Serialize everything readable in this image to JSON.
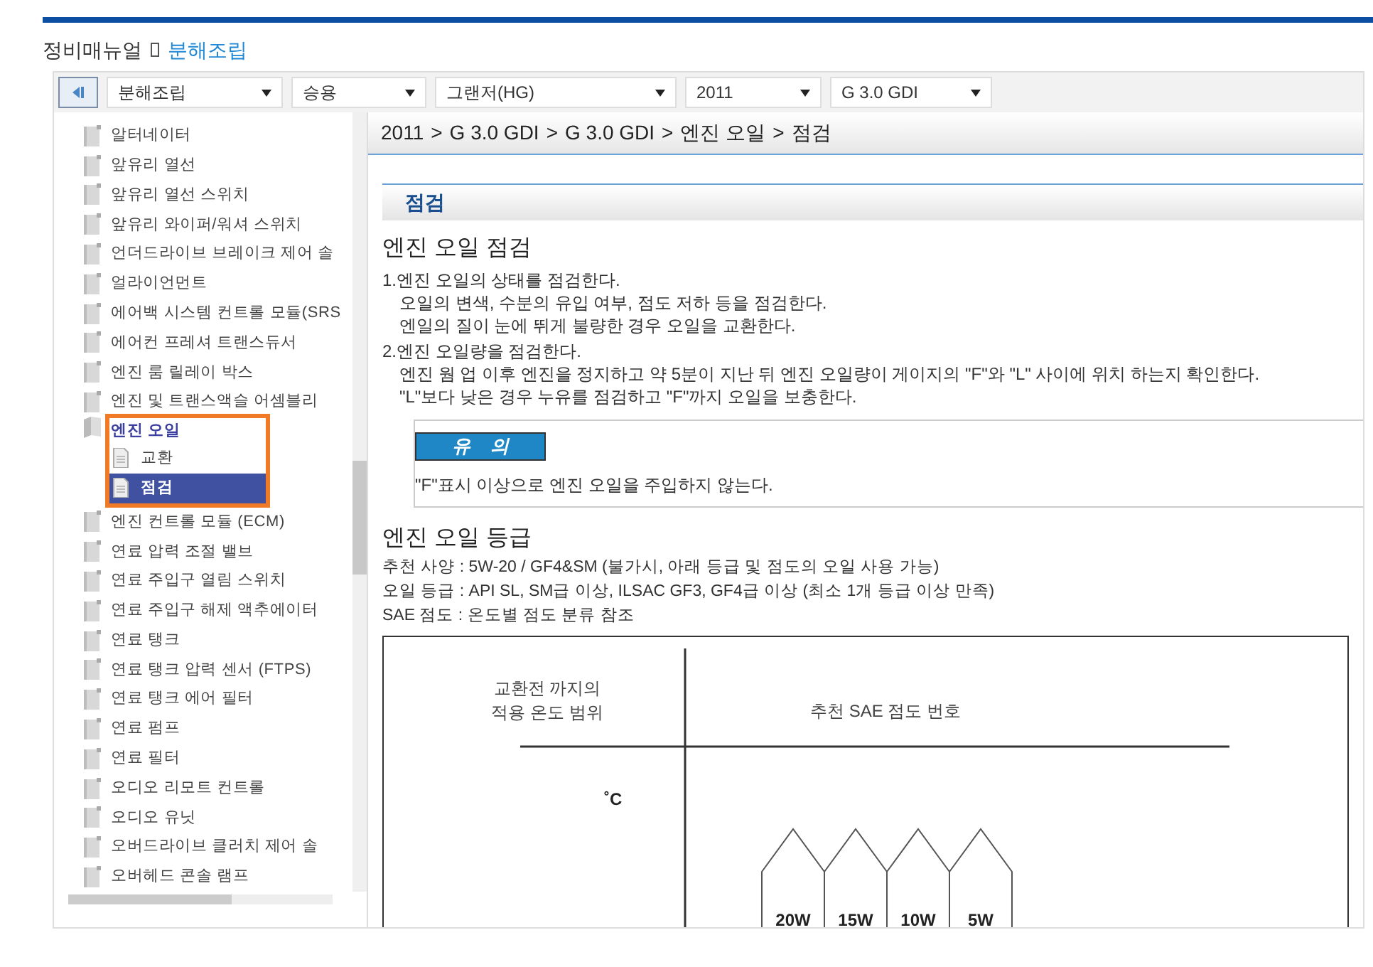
{
  "header": {
    "root": "정비매뉴얼",
    "current": "분해조립"
  },
  "filters": [
    {
      "value": "분해조립"
    },
    {
      "value": "승용"
    },
    {
      "value": "그랜저(HG)"
    },
    {
      "value": "2011"
    },
    {
      "value": "G 3.0 GDI"
    }
  ],
  "tree": [
    {
      "label": "알터네이터",
      "expanded": false
    },
    {
      "label": "앞유리 열선",
      "expanded": false
    },
    {
      "label": "앞유리 열선 스위치",
      "expanded": false
    },
    {
      "label": "앞유리 와이퍼/워셔 스위치",
      "expanded": false
    },
    {
      "label": "언더드라이브 브레이크 제어 솔",
      "expanded": false
    },
    {
      "label": "얼라이언먼트",
      "expanded": false
    },
    {
      "label": "에어백 시스템 컨트롤 모듈(SRS",
      "expanded": false
    },
    {
      "label": "에어컨 프레셔 트랜스듀서",
      "expanded": false
    },
    {
      "label": "엔진 룸 릴레이 박스",
      "expanded": false
    },
    {
      "label": "엔진 및 트랜스액슬 어셈블리",
      "expanded": false
    },
    {
      "label": "엔진 오일",
      "expanded": true,
      "annotated": true,
      "children": [
        {
          "label": "교환",
          "selected": false
        },
        {
          "label": "점검",
          "selected": true
        }
      ]
    },
    {
      "label": "엔진 컨트롤 모듈 (ECM)",
      "expanded": false
    },
    {
      "label": "연료 압력 조절 밸브",
      "expanded": false
    },
    {
      "label": "연료 주입구 열림 스위치",
      "expanded": false
    },
    {
      "label": "연료 주입구 해제 액추에이터",
      "expanded": false
    },
    {
      "label": "연료 탱크",
      "expanded": false
    },
    {
      "label": "연료 탱크 압력 센서 (FTPS)",
      "expanded": false
    },
    {
      "label": "연료 탱크 에어 필터",
      "expanded": false
    },
    {
      "label": "연료 펌프",
      "expanded": false
    },
    {
      "label": "연료 필터",
      "expanded": false
    },
    {
      "label": "오디오 리모트 컨트롤",
      "expanded": false
    },
    {
      "label": "오디오 유닛",
      "expanded": false
    },
    {
      "label": "오버드라이브 클러치 제어 솔",
      "expanded": false
    },
    {
      "label": "오버헤드 콘솔 램프",
      "expanded": false
    }
  ],
  "breadcrumb": [
    {
      "label": "2011"
    },
    {
      "separator": ">",
      "label": "G 3.0 GDI"
    },
    {
      "separator": ">",
      "label": "G 3.0 GDI"
    },
    {
      "separator": ">",
      "label": "엔진 오일"
    },
    {
      "separator": ">",
      "label": "점검"
    }
  ],
  "section_title": "점검",
  "sections": [
    {
      "heading": "엔진 오일 점검",
      "steps": [
        {
          "number": "1.",
          "title": "엔진 오일의 상태를 점검한다.",
          "lines": [
            "오일의 변색, 수분의 유입 여부, 점도 저하 등을 점검한다.",
            "엔일의 질이 눈에 뛰게 불량한 경우 오일을 교환한다."
          ]
        },
        {
          "number": "2.",
          "title": "엔진 오일량을 점검한다.",
          "lines": [
            "엔진 웜 업 이후 엔진을 정지하고 약 5분이 지난 뒤 엔진 오일량이 게이지의 \"F\"와 \"L\" 사이에 위치 하는지 확인한다.",
            "\"L\"보다 낮은 경우 누유를 점검하고 \"F\"까지 오일을 보충한다."
          ]
        }
      ],
      "caution": {
        "label": "유    의",
        "text": "\"F\"표시 이상으로 엔진 오일을 주입하지 않는다."
      }
    },
    {
      "heading": "엔진 오일 등급",
      "lines": [
        "추천 사양 : 5W-20 / GF4&SM (불가시, 아래 등급 및 점도의 오일 사용 가능)",
        "오일 등급 : API SL, SM급 이상, ILSAC GF3, GF4급 이상 (최소 1개 등급 이상 만족)",
        "SAE 점도 : 온도별 점도 분류 참조"
      ]
    }
  ],
  "figure": {
    "left_header": [
      "교환전 까지의",
      "적용 온도 범위"
    ],
    "right_header": "추천 SAE 점도 번호",
    "unit": "˚C",
    "grades": [
      "20W",
      "15W",
      "10W",
      "5W"
    ]
  }
}
